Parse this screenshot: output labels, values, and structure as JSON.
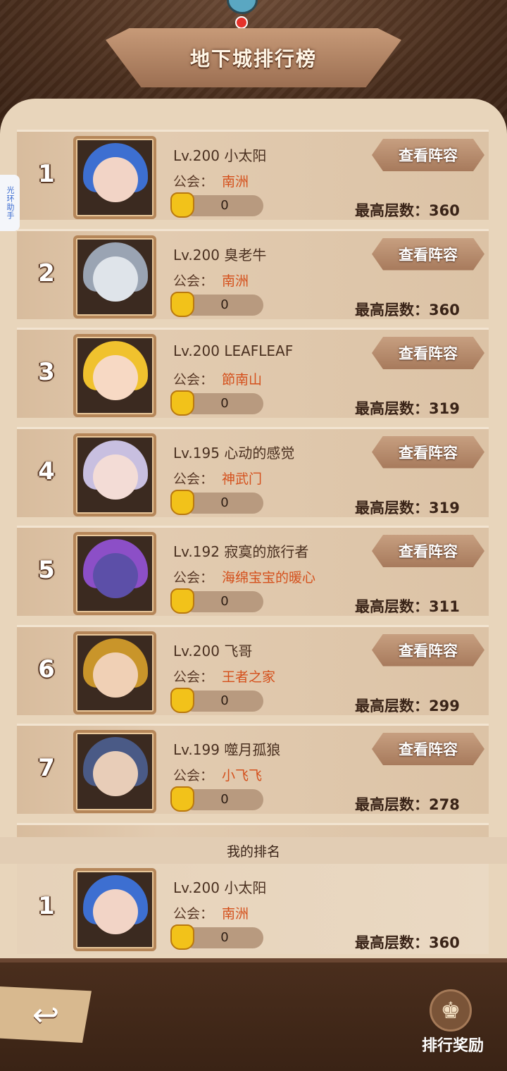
{
  "header": {
    "title": "地下城排行榜"
  },
  "helper_tab": {
    "label": "光环助手"
  },
  "labels": {
    "guild_prefix": "公会：",
    "view_button": "查看阵容",
    "floor_prefix": "最高层数："
  },
  "rankings": [
    {
      "rank": "1",
      "level_name": "Lv.200 小太阳",
      "guild": "南洲",
      "likes": "0",
      "max_floor": "360",
      "avatar_colors": [
        "#3d6fd1",
        "#f2d4c6"
      ]
    },
    {
      "rank": "2",
      "level_name": "Lv.200 臭老牛",
      "guild": "南洲",
      "likes": "0",
      "max_floor": "360",
      "avatar_colors": [
        "#9aa4b3",
        "#dfe4ea"
      ]
    },
    {
      "rank": "3",
      "level_name": "Lv.200 LEAFLEAF",
      "guild": "節南山",
      "likes": "0",
      "max_floor": "319",
      "avatar_colors": [
        "#f0c22e",
        "#f7d9c4"
      ]
    },
    {
      "rank": "4",
      "level_name": "Lv.195 心动的感觉",
      "guild": "神武门",
      "likes": "0",
      "max_floor": "319",
      "avatar_colors": [
        "#c8bfe0",
        "#f3dcd6"
      ]
    },
    {
      "rank": "5",
      "level_name": "Lv.192 寂寞的旅行者",
      "guild": "海绵宝宝的暖心",
      "likes": "0",
      "max_floor": "311",
      "avatar_colors": [
        "#8c4fc7",
        "#5c4fa8"
      ]
    },
    {
      "rank": "6",
      "level_name": "Lv.200 飞哥",
      "guild": "王者之家",
      "likes": "0",
      "max_floor": "299",
      "avatar_colors": [
        "#c9952a",
        "#f0d0b5"
      ]
    },
    {
      "rank": "7",
      "level_name": "Lv.199 噬月孤狼",
      "guild": "小飞飞",
      "likes": "0",
      "max_floor": "278",
      "avatar_colors": [
        "#4a5a86",
        "#e8cdb8"
      ]
    }
  ],
  "my_rank": {
    "header": "我的排名",
    "rank": "1",
    "level_name": "Lv.200 小太阳",
    "guild": "南洲",
    "likes": "0",
    "max_floor": "360",
    "avatar_colors": [
      "#3d6fd1",
      "#f2d4c6"
    ]
  },
  "bottom": {
    "back_icon": "back-arrow-icon",
    "reward_label": "排行奖励",
    "reward_icon": "chess-king-icon"
  }
}
